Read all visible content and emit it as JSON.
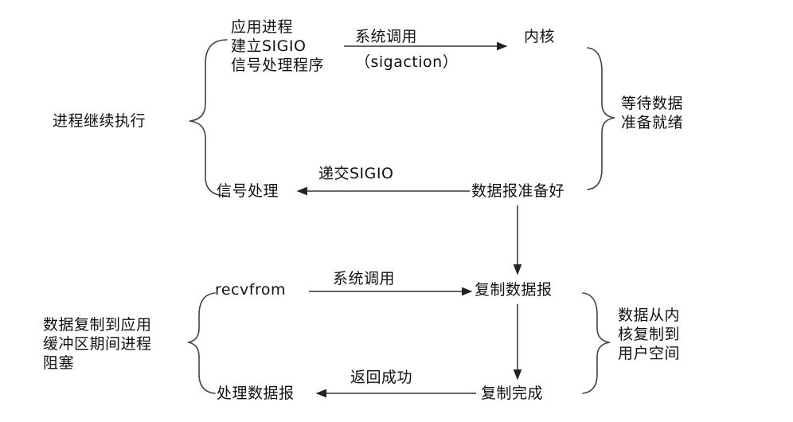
{
  "top": {
    "app_process": "应用进程\n建立SIGIO\n信号处理程序",
    "syscall": "系统调用",
    "sigaction": "（sigaction）",
    "kernel": "内核",
    "wait_data": "等待数据\n准备就绪",
    "continue_exec": "进程继续执行",
    "deliver_sigio": "递交SIGIO",
    "signal_handle": "信号处理",
    "datagram_ready": "数据报准备好"
  },
  "bottom": {
    "recvfrom": "recvfrom",
    "syscall": "系统调用",
    "copy_datagram": "复制数据报",
    "copy_desc": "数据从内\n核复制到\n用户空间",
    "blocked_desc": "数据复制到应用\n缓冲区期间进程\n阻塞",
    "return_success": "返回成功",
    "process_datagram": "处理数据报",
    "copy_complete": "复制完成"
  }
}
